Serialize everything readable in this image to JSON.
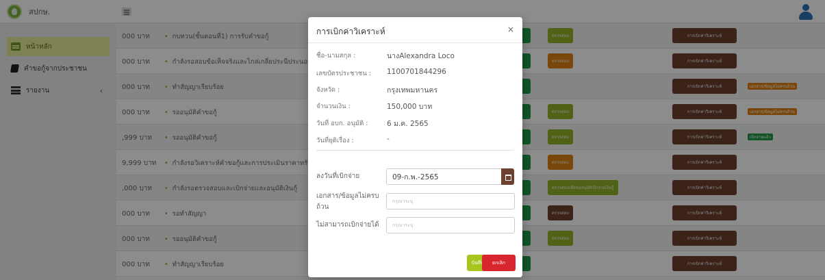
{
  "app": {
    "brand": "สปกษ."
  },
  "sidebar": {
    "items": [
      {
        "label": "หน้าหลัก",
        "icon": "home-icon",
        "active": true
      },
      {
        "label": "คำขอกู้จากประชาชน",
        "icon": "book-icon",
        "active": false
      },
      {
        "label": "รายงาน",
        "icon": "list-icon",
        "active": false,
        "chevron": "‹"
      }
    ]
  },
  "table": {
    "rows": [
      {
        "amount": "000 บาท",
        "status": "กบทวน(ขั้นตอนที่1) การรับคำขอกู้",
        "check_label": "ตรวจสอบ",
        "check_color": "#92b327",
        "disburse_label": "การเบิกค่าวิเคราะห์",
        "badge": ""
      },
      {
        "amount": "000 บาท",
        "status": "กำลังรอสอบข้อเท็จจริงและไกล่เกลี่ยประนีประนอม",
        "check_label": "ตรวจสอบ",
        "check_color": "#df8214",
        "disburse_label": "การเบิกค่าวิเคราะห์",
        "badge": ""
      },
      {
        "amount": "000 บาท",
        "status": "ทำสัญญาเรียบร้อย",
        "check_label": "",
        "check_color": "",
        "disburse_label": "การเบิกค่าวิเคราะห์",
        "badge": "เอกสาร/ข้อมูลไม่ครบถ้วน",
        "badge_color": "#df8214"
      },
      {
        "amount": "000 บาท",
        "status": "รออนุมัติคำขอกู้",
        "check_label": "ตรวจสอบ",
        "check_color": "#92b327",
        "disburse_label": "การเบิกค่าวิเคราะห์",
        "badge": "เอกสาร/ข้อมูลไม่ครบถ้วน",
        "badge_color": "#df8214"
      },
      {
        "amount": ",999 บาท",
        "status": "รออนุมัติคำขอกู้",
        "check_label": "ตรวจสอบ",
        "check_color": "#92b327",
        "disburse_label": "การเบิกค่าวิเคราะห์",
        "badge": "เบิกจ่ายแล้ว",
        "badge_color": "#1f9a47"
      },
      {
        "amount": "9,999 บาท",
        "status": "กำลังรอวิเคราะห์คำขอกู้และการประเมินราคาทรัพย์",
        "check_label": "ตรวจสอบ",
        "check_color": "#df8214",
        "disburse_label": "การเบิกค่าวิเคราะห์",
        "badge": ""
      },
      {
        "amount": ",000 บาท",
        "status": "กำลังรอตรวจสอบและเบิกจ่ายและอนุมัติเงินกู้",
        "check_label": "ตรวจสอบเพื่อขออนุมัติเบิกจ่ายเงินกู้",
        "check_color": "#92b327",
        "disburse_label": "การเบิกค่าวิเคราะห์",
        "badge": ""
      },
      {
        "amount": "000 บาท",
        "status": "รอทำสัญญา",
        "check_label": "ตรวจสอบ",
        "check_color": "#6e4031",
        "disburse_label": "การเบิกค่าวิเคราะห์",
        "badge": ""
      },
      {
        "amount": "000 บาท",
        "status": "รออนุมัติคำขอกู้",
        "check_label": "ตรวจสอบ",
        "check_color": "#92b327",
        "disburse_label": "การเบิกค่าวิเคราะห์",
        "badge": ""
      },
      {
        "amount": "000 บาท",
        "status": "ทำสัญญาเรียบร้อย",
        "check_label": "",
        "check_color": "",
        "disburse_label": "การเบิกค่าวิเคราะห์",
        "badge": ""
      }
    ]
  },
  "modal": {
    "title": "การเบิกค่าวิเคราะห์",
    "close": "×",
    "info": [
      {
        "label": "ชื่อ-นามสกุล :",
        "value": "นางAlexandra Loco"
      },
      {
        "label": "เลขบัตรประชาชน :",
        "value": "1100701844296"
      },
      {
        "label": "จังหวัด :",
        "value": "กรุงเทพมหานคร"
      },
      {
        "label": "จำนวนเงิน :",
        "value": "150,000 บาท"
      },
      {
        "label": "วันที่ อบก. อนุมัติ :",
        "value": "6 ม.ค. 2565"
      },
      {
        "label": "วันที่ยุติเรื่อง :",
        "value": "-"
      }
    ],
    "form": {
      "date_label": "ลงวันที่เบิกจ่าย",
      "date_value": "09-ก.พ.-2565",
      "incomplete_label": "เอกสาร/ข้อมูลไม่ครบถ้วน",
      "incomplete_placeholder": "กรุณาระบุ",
      "cannot_label": "ไม่สามารถเบิกจ่ายได้",
      "cannot_placeholder": "กรุณาระบุ"
    },
    "save_label": "บันทึก",
    "cancel_label": "ยกเลิก"
  },
  "colors": {
    "accent_green": "#92b327",
    "brown": "#6e4031",
    "danger": "#d8262e",
    "orange": "#df8214"
  }
}
